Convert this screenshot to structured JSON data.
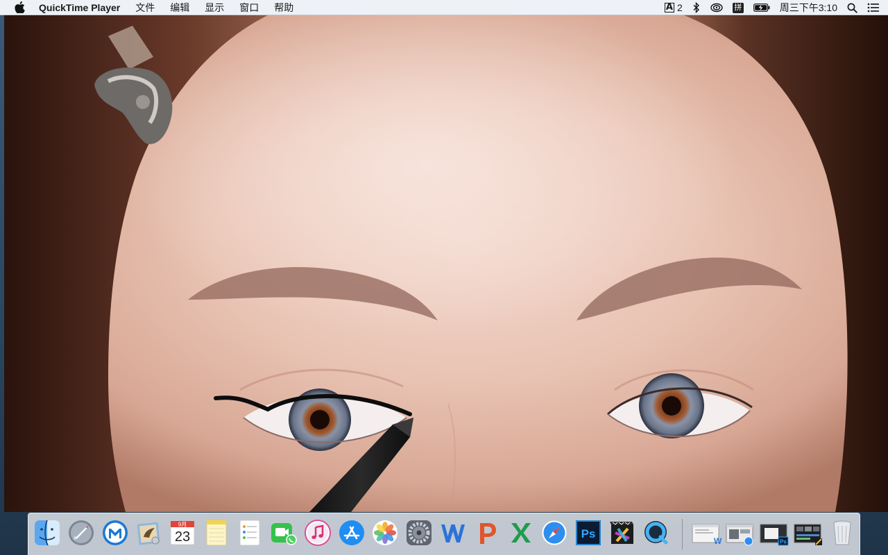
{
  "menubar": {
    "app_name": "QuickTime Player",
    "menus": [
      "文件",
      "编辑",
      "显示",
      "窗口",
      "帮助"
    ],
    "status": {
      "adobe_count": "2",
      "input_method": "拼",
      "clock": "周三下午3:10"
    }
  },
  "dock": {
    "apps": [
      {
        "name": "Finder",
        "icon": "finder-icon",
        "running": true
      },
      {
        "name": "Launchpad",
        "icon": "launchpad-icon",
        "running": false
      },
      {
        "name": "Maxthon",
        "icon": "maxthon-icon",
        "running": false
      },
      {
        "name": "Mail",
        "icon": "mail-icon",
        "running": false
      },
      {
        "name": "Calendar",
        "icon": "calendar-icon",
        "running": false,
        "month": "9月",
        "day": "23"
      },
      {
        "name": "Notes",
        "icon": "notes-icon",
        "running": false
      },
      {
        "name": "Reminders",
        "icon": "reminders-icon",
        "running": false
      },
      {
        "name": "FaceTime",
        "icon": "facetime-icon",
        "running": false
      },
      {
        "name": "iTunes",
        "icon": "itunes-icon",
        "running": true
      },
      {
        "name": "App Store",
        "icon": "app-store-icon",
        "running": false
      },
      {
        "name": "Photos",
        "icon": "photos-icon",
        "running": false
      },
      {
        "name": "System Preferences",
        "icon": "system-preferences-icon",
        "running": false
      },
      {
        "name": "Word",
        "icon": "word-icon",
        "running": true
      },
      {
        "name": "PowerPoint",
        "icon": "powerpoint-icon",
        "running": false
      },
      {
        "name": "Excel",
        "icon": "excel-icon",
        "running": false
      },
      {
        "name": "Safari",
        "icon": "safari-icon",
        "running": true
      },
      {
        "name": "Photoshop",
        "icon": "photoshop-icon",
        "running": true
      },
      {
        "name": "Final Cut Pro",
        "icon": "final-cut-pro-icon",
        "running": true
      },
      {
        "name": "QuickTime Player",
        "icon": "quicktime-icon",
        "running": true
      }
    ],
    "minimized": [
      {
        "name": "Word document window",
        "icon": "minimized-word-window-icon"
      },
      {
        "name": "Safari window",
        "icon": "minimized-safari-window-icon"
      },
      {
        "name": "Photoshop window",
        "icon": "minimized-photoshop-window-icon"
      },
      {
        "name": "Final Cut Pro window",
        "icon": "minimized-final-cut-window-icon"
      }
    ],
    "trash": {
      "name": "Trash",
      "icon": "trash-icon"
    }
  },
  "video": {
    "content": "video-frame"
  }
}
